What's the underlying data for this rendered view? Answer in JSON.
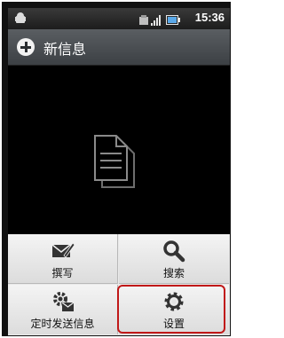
{
  "status_bar": {
    "time": "15:36"
  },
  "title_bar": {
    "title": "新信息"
  },
  "menu": {
    "items": [
      {
        "label": "撰写",
        "icon": "compose-icon"
      },
      {
        "label": "搜索",
        "icon": "search-icon"
      },
      {
        "label": "定时发送信息",
        "icon": "scheduled-message-icon"
      },
      {
        "label": "设置",
        "icon": "gear-icon"
      }
    ],
    "highlighted": "设置",
    "highlight_color": "#c01818"
  }
}
